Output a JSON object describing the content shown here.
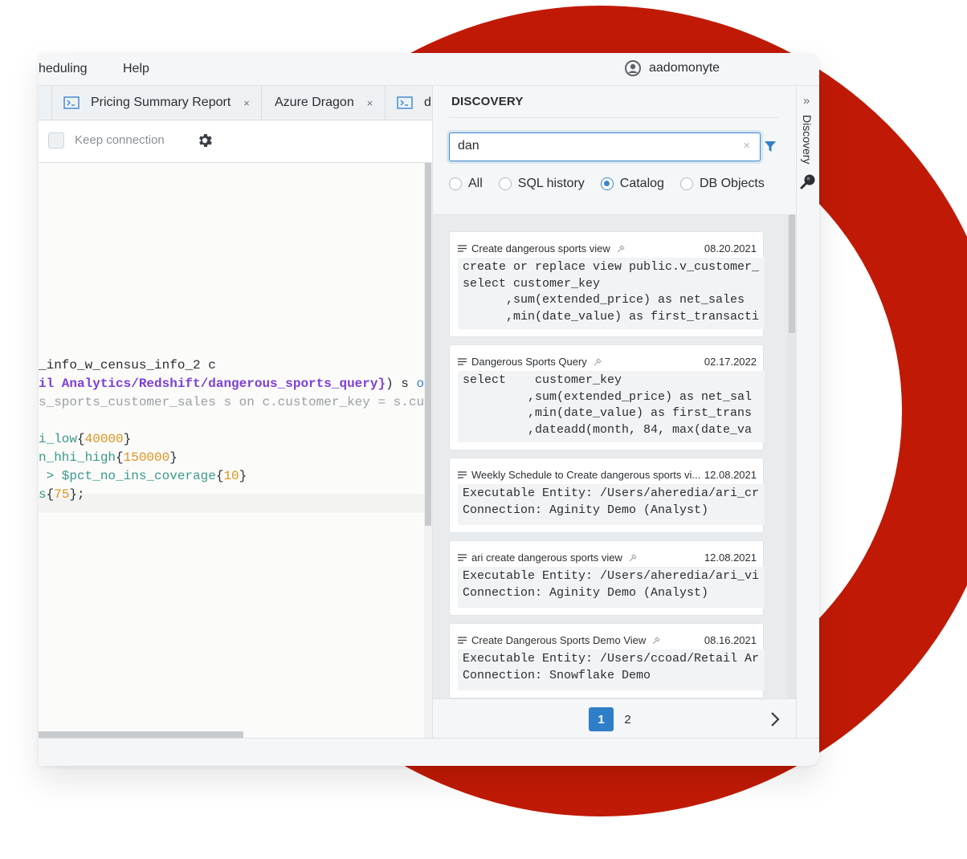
{
  "colors": {
    "ring": "#c01a06",
    "accent": "#3a86cf",
    "purple": "#7c3fd6",
    "green": "#3b9a8a",
    "orange": "#e0921a"
  },
  "menubar": {
    "items": [
      "heduling",
      "Help"
    ],
    "user": "aadomonyte"
  },
  "tabs": [
    {
      "label": "Pricing Summary Report",
      "close": "×",
      "icon": "terminal-icon"
    },
    {
      "label": "Azure Dragon",
      "close": "×"
    },
    {
      "label": "d",
      "icon": "terminal-icon"
    }
  ],
  "toolbar": {
    "keep_connection": "Keep connection"
  },
  "editor": {
    "line1": "_info_w_census_info_2 c",
    "line2a": "il Analytics/Redshift/dangerous_sports_query}",
    "line2b": ") s ",
    "line2c": "on ",
    "line3": "s_sports_customer_sales s on c.customer_key = s.custo",
    "line4a": "i_low",
    "line4b": "40000",
    "line5a": "n_hhi_high",
    "line5b": "150000",
    "line6a": " > $pct_no_ins_coverage",
    "line6b": "10",
    "line7a": "s",
    "line7b": "75"
  },
  "discovery": {
    "title": "DISCOVERY",
    "search_value": "dan",
    "clear": "×",
    "radios": [
      "All",
      "SQL history",
      "Catalog",
      "DB Objects"
    ],
    "selected": "Catalog",
    "results": [
      {
        "title": "Create dangerous sports view",
        "date": "08.20.2021",
        "lines": [
          "create or replace view public.v_customer_",
          "select customer_key",
          "      ,sum(extended_price) as net_sales",
          "      ,min(date_value) as first_transacti"
        ]
      },
      {
        "title": "Dangerous Sports Query",
        "date": "02.17.2022",
        "lines": [
          "select    customer_key",
          "         ,sum(extended_price) as net_sal",
          "         ,min(date_value) as first_trans",
          "         ,dateadd(month, 84, max(date_va"
        ]
      },
      {
        "title": "Weekly Schedule to Create dangerous sports vi...",
        "date": "12.08.2021",
        "lines": [
          "Executable Entity: /Users/aheredia/ari_cr",
          "Connection: Aginity Demo (Analyst)"
        ]
      },
      {
        "title": "ari create dangerous sports view",
        "date": "12.08.2021",
        "lines": [
          "Executable Entity: /Users/aheredia/ari_vi",
          "Connection: Aginity Demo (Analyst)"
        ]
      },
      {
        "title": "Create Dangerous Sports Demo View",
        "date": "08.16.2021",
        "lines": [
          "Executable Entity: /Users/ccoad/Retail Ar",
          "Connection: Snowflake Demo"
        ]
      }
    ],
    "pages": [
      "1",
      "2"
    ],
    "current_page": "1"
  },
  "rail": {
    "label": "Discovery"
  }
}
